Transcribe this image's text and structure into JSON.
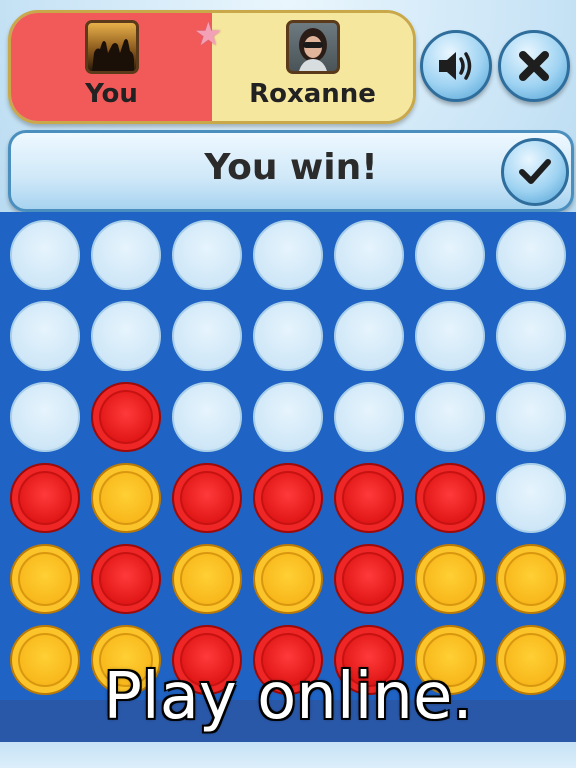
{
  "players": {
    "left": {
      "name": "You",
      "avatar_icon": "group-photo-avatar",
      "color": "#f25a5a"
    },
    "right": {
      "name": "Roxanne",
      "avatar_icon": "woman-photo-avatar",
      "color": "#f6e79f"
    }
  },
  "turn_indicator_icon": "star-icon",
  "buttons": {
    "sound_icon": "speaker-icon",
    "close_icon": "close-icon",
    "confirm_icon": "checkmark-icon"
  },
  "status": {
    "text": "You win!"
  },
  "board": {
    "rows": 6,
    "cols": 7,
    "cells": [
      [
        "empty",
        "empty",
        "empty",
        "empty",
        "empty",
        "empty",
        "empty"
      ],
      [
        "empty",
        "empty",
        "empty",
        "empty",
        "empty",
        "empty",
        "empty"
      ],
      [
        "empty",
        "red",
        "empty",
        "empty",
        "empty",
        "empty",
        "empty"
      ],
      [
        "red",
        "yellow",
        "red",
        "red",
        "red",
        "red",
        "empty"
      ],
      [
        "yellow",
        "red",
        "yellow",
        "yellow",
        "red",
        "yellow",
        "yellow"
      ],
      [
        "yellow",
        "yellow",
        "red",
        "red",
        "red",
        "yellow",
        "yellow"
      ]
    ],
    "colors": {
      "red": "#e21818",
      "yellow": "#f8b81c",
      "board": "#1f63c4"
    }
  },
  "caption": "Play online."
}
